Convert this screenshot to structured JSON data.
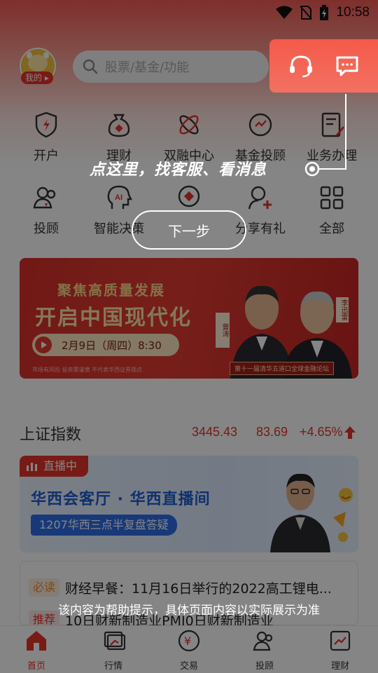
{
  "status_bar": {
    "time": "10:58"
  },
  "header": {
    "avatar_tag": "我的",
    "search_placeholder": "股票/基金/功能"
  },
  "quick_grid": {
    "row1": [
      "开户",
      "理财",
      "双融中心",
      "基金投顾",
      "业务办理"
    ],
    "row2": [
      "投顾",
      "智能决策",
      "",
      "分享有礼",
      "全部"
    ]
  },
  "banner": {
    "headline_small": "聚焦高质量发展",
    "headline_big": "开启中国现代化",
    "date": "2月9日（周四）8:30",
    "fine_print": "市场有风险  投资需谨慎  不代表华西证券观点",
    "forum": "第十一届清华五道口全球金融论坛",
    "name1": "曾涛",
    "name2": "李迅雷"
  },
  "index": {
    "name": "上证指数",
    "price": "3445.43",
    "change": "83.69",
    "percent": "+4.65%",
    "trend_color": "#e6332a"
  },
  "live": {
    "badge": "直播中",
    "title": "华西会客厅 · 华西直播间",
    "subtitle": "1207华西三点半复盘答疑"
  },
  "news": {
    "tag1": "必读",
    "item1": "财经早餐：11月16日举行的2022高工锂电...",
    "tag2": "推荐",
    "item2": "10日财新制造业PMI0日财新制造业"
  },
  "bottom_nav": [
    "首页",
    "行情",
    "交易",
    "投顾",
    "理财"
  ],
  "guide": {
    "tip": "点这里，找客服、看消息",
    "next_button": "下一步",
    "disclaimer": "该内容为帮助提示，具体页面内容以实际展示为准"
  },
  "colors": {
    "accent": "#e6332a",
    "panel": "#f45a4b"
  }
}
